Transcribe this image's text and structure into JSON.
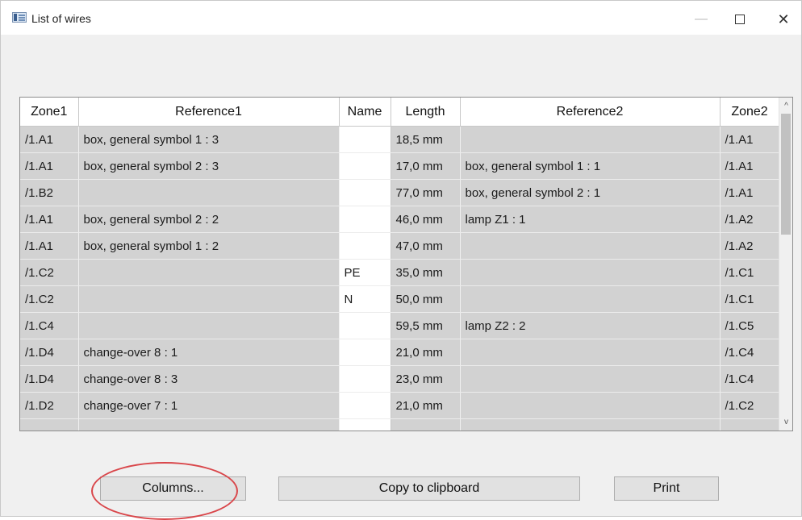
{
  "window": {
    "title": "List of wires",
    "minimize_glyph": "—",
    "close_glyph": "✕"
  },
  "table": {
    "columns": [
      "Zone1",
      "Reference1",
      "Name",
      "Length",
      "Reference2",
      "Zone2"
    ],
    "rows": [
      [
        "/1.A1",
        "box, general symbol 1 : 3",
        "",
        "18,5 mm",
        "",
        "/1.A1"
      ],
      [
        "/1.A1",
        "box, general symbol 2 : 3",
        "",
        "17,0 mm",
        "box, general symbol 1 : 1",
        "/1.A1"
      ],
      [
        "/1.B2",
        "",
        "",
        "77,0 mm",
        "box, general symbol 2 : 1",
        "/1.A1"
      ],
      [
        "/1.A1",
        "box, general symbol 2 : 2",
        "",
        "46,0 mm",
        "lamp Z1 : 1",
        "/1.A2"
      ],
      [
        "/1.A1",
        "box, general symbol 1 : 2",
        "",
        "47,0 mm",
        "",
        "/1.A2"
      ],
      [
        "/1.C2",
        "",
        "PE",
        "35,0 mm",
        "",
        "/1.C1"
      ],
      [
        "/1.C2",
        "",
        "N",
        "50,0 mm",
        "",
        "/1.C1"
      ],
      [
        "/1.C4",
        "",
        "",
        "59,5 mm",
        "lamp Z2 : 2",
        "/1.C5"
      ],
      [
        "/1.D4",
        "change-over 8 : 1",
        "",
        "21,0 mm",
        "",
        "/1.C4"
      ],
      [
        "/1.D4",
        "change-over 8 : 3",
        "",
        "23,0 mm",
        "",
        "/1.C4"
      ],
      [
        "/1.D2",
        "change-over 7 : 1",
        "",
        "21,0 mm",
        "",
        "/1.C2"
      ]
    ]
  },
  "scrollbar": {
    "up_glyph": "^",
    "down_glyph": "v"
  },
  "buttons": {
    "columns": "Columns...",
    "copy": "Copy to clipboard",
    "print": "Print"
  },
  "colors": {
    "cell_background": "#d2d2d2",
    "annotation_circle": "#d9464a"
  }
}
